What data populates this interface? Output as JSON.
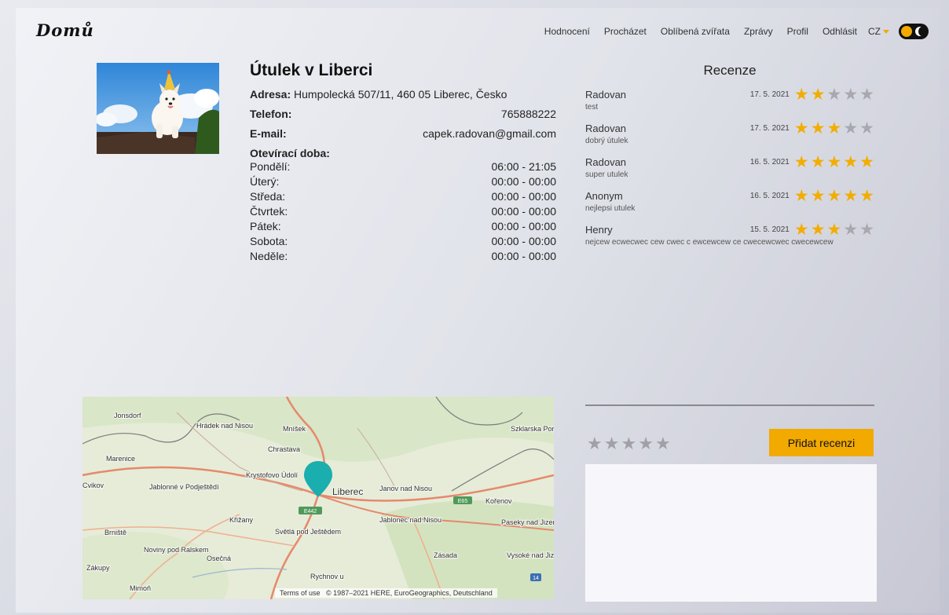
{
  "brand": "Domů",
  "nav": {
    "items": [
      "Hodnocení",
      "Procházet",
      "Oblíbená zvířata",
      "Zprávy",
      "Profil",
      "Odhlásit"
    ],
    "language": "CZ"
  },
  "shelter": {
    "name": "Útulek v Liberci",
    "address_label": "Adresa:",
    "address": "Humpolecká 507/11, 460 05 Liberec, Česko",
    "phone_label": "Telefon:",
    "phone": "765888222",
    "email_label": "E-mail:",
    "email": "capek.radovan@gmail.com",
    "hours_label": "Otevírací doba:",
    "hours": [
      {
        "day": "Pondělí:",
        "time": "06:00 - 21:05"
      },
      {
        "day": "Úterý:",
        "time": "00:00 - 00:00"
      },
      {
        "day": "Středa:",
        "time": "00:00 - 00:00"
      },
      {
        "day": "Čtvrtek:",
        "time": "00:00 - 00:00"
      },
      {
        "day": "Pátek:",
        "time": "00:00 - 00:00"
      },
      {
        "day": "Sobota:",
        "time": "00:00 - 00:00"
      },
      {
        "day": "Neděle:",
        "time": "00:00 - 00:00"
      }
    ]
  },
  "reviews": {
    "title": "Recenze",
    "items": [
      {
        "author": "Radovan",
        "date": "17. 5. 2021",
        "rating": 2,
        "text": "test"
      },
      {
        "author": "Radovan",
        "date": "17. 5. 2021",
        "rating": 3,
        "text": "dobrý útulek"
      },
      {
        "author": "Radovan",
        "date": "16. 5. 2021",
        "rating": 5,
        "text": "super utulek"
      },
      {
        "author": "Anonym",
        "date": "16. 5. 2021",
        "rating": 5,
        "text": "nejlepsi utulek"
      },
      {
        "author": "Henry",
        "date": "15. 5. 2021",
        "rating": 3,
        "text": "nejcew ecwecwec cew cwec c ewcewcew ce cwecewcwec cwecewcew"
      }
    ]
  },
  "map": {
    "credit_terms": "Terms of use",
    "credit": "© 1987–2021 HERE, EuroGeographics, Deutschland",
    "labels": [
      "Jonsdorf",
      "Hrádek nad Nisou",
      "Mníšek",
      "Szklarska Poręba",
      "Chrastava",
      "Marenice",
      "Krystofovo Údolí",
      "Liberec",
      "Janov nad Nisou",
      "Kořenov",
      "Jablonné v Podještědí",
      "Křižany",
      "Jablonec nad Nisou",
      "Paseky nad Jizerou",
      "Brniště",
      "Světlá pod Ještědem",
      "Noviny pod Ralskem",
      "Osečná",
      "Zásada",
      "Vysoké nad Jizerou",
      "Zákupy",
      "Mimoň",
      "Rychnov u",
      "Cvikov"
    ],
    "roads": [
      "E442",
      "E65",
      "14"
    ]
  },
  "review_form": {
    "button": "Přidat recenzi",
    "rating": 0
  },
  "colors": {
    "accent": "#f2a900",
    "star_off": "#a8a8ae",
    "map_marker": "#1aaeae"
  }
}
